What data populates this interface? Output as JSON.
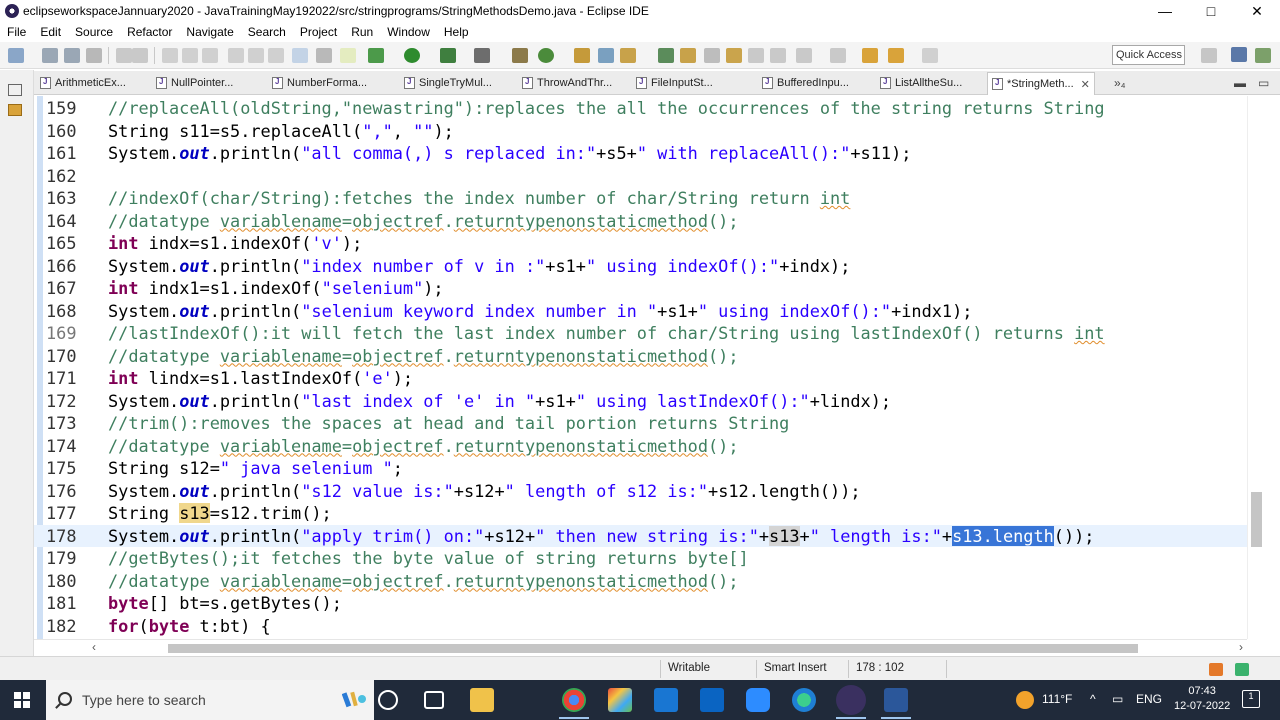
{
  "window": {
    "title": "eclipseworkspaceJannuary2020 - JavaTrainingMay192022/src/stringprograms/StringMethodsDemo.java - Eclipse IDE",
    "min": "—",
    "max": "□",
    "close": "✕"
  },
  "menu": [
    "File",
    "Edit",
    "Source",
    "Refactor",
    "Navigate",
    "Search",
    "Project",
    "Run",
    "Window",
    "Help"
  ],
  "toolbar": {
    "quick_access": "Quick Access"
  },
  "tabs": [
    {
      "label": "ArithmeticEx..."
    },
    {
      "label": "NullPointer..."
    },
    {
      "label": "NumberForma..."
    },
    {
      "label": "SingleTryMul..."
    },
    {
      "label": "ThrowAndThr..."
    },
    {
      "label": "FileInputSt..."
    },
    {
      "label": "BufferedInpu..."
    },
    {
      "label": "ListAlltheSu..."
    },
    {
      "label": "*StringMeth...",
      "active": true,
      "close": "✕"
    }
  ],
  "tab_overflow": "»₄",
  "editor": {
    "lines": [
      {
        "n": "159"
      },
      {
        "n": "160"
      },
      {
        "n": "161"
      },
      {
        "n": "162"
      },
      {
        "n": "163"
      },
      {
        "n": "164"
      },
      {
        "n": "165"
      },
      {
        "n": "166"
      },
      {
        "n": "167"
      },
      {
        "n": "168"
      },
      {
        "n": "169"
      },
      {
        "n": "170"
      },
      {
        "n": "171"
      },
      {
        "n": "172"
      },
      {
        "n": "173"
      },
      {
        "n": "174"
      },
      {
        "n": "175"
      },
      {
        "n": "176"
      },
      {
        "n": "177"
      },
      {
        "n": "178"
      },
      {
        "n": "179"
      },
      {
        "n": "180"
      },
      {
        "n": "181"
      },
      {
        "n": "182"
      }
    ],
    "code": {
      "l159a": "//replaceAll(oldString,\"newastring\"):replaces the all the occurrences of the string returns String",
      "l160a": "String s11=s5.replaceAll(",
      "l160b": "\",\"",
      "l160c": ", ",
      "l160d": "\"\"",
      "l160e": ");",
      "l161a": "System.",
      "l161b": "out",
      "l161c": ".println(",
      "l161d": "\"all comma(,) s replaced in:\"",
      "l161e": "+s5+",
      "l161f": "\" with replaceAll():\"",
      "l161g": "+s11);",
      "l163a": "//indexOf(char/String):fetches the index number of char/String return ",
      "l163b": "int",
      "l164a": "//datatype ",
      "l164b": "variablename",
      "l164c": "=",
      "l164d": "objectref",
      "l164e": ".",
      "l164f": "returntypenonstaticmethod",
      "l164g": "();",
      "l165a": "int",
      "l165b": " indx=s1.indexOf(",
      "l165c": "'v'",
      "l165d": ");",
      "l166a": "System.",
      "l166b": "out",
      "l166c": ".println(",
      "l166d": "\"index number of v in :\"",
      "l166e": "+s1+",
      "l166f": "\" using indexOf():\"",
      "l166g": "+indx);",
      "l167a": "int",
      "l167b": " indx1=s1.indexOf(",
      "l167c": "\"selenium\"",
      "l167d": ");",
      "l168a": "System.",
      "l168b": "out",
      "l168c": ".println(",
      "l168d": "\"selenium keyword index number in \"",
      "l168e": "+s1+",
      "l168f": "\" using indexOf():\"",
      "l168g": "+indx1);",
      "l169a": "//lastIndexOf():it will fetch the last index number of char/String using lastIndexOf() returns ",
      "l169b": "int",
      "l170a": "//datatype ",
      "l170b": "variablename",
      "l170c": "=",
      "l170d": "objectref",
      "l170e": ".",
      "l170f": "returntypenonstaticmethod",
      "l170g": "();",
      "l171a": "int",
      "l171b": " lindx=s1.lastIndexOf(",
      "l171c": "'e'",
      "l171d": ");",
      "l172a": "System.",
      "l172b": "out",
      "l172c": ".println(",
      "l172d": "\"last index of 'e' in \"",
      "l172e": "+s1+",
      "l172f": "\" using lastIndexOf():\"",
      "l172g": "+lindx);",
      "l173a": "//trim():removes the spaces at head and tail portion returns String",
      "l174a": "//datatype ",
      "l174b": "variablename",
      "l174c": "=",
      "l174d": "objectref",
      "l174e": ".",
      "l174f": "returntypenonstaticmethod",
      "l174g": "();",
      "l175a": "String s12=",
      "l175b": "\" java selenium \"",
      "l175c": ";",
      "l176a": "System.",
      "l176b": "out",
      "l176c": ".println(",
      "l176d": "\"s12 value is:\"",
      "l176e": "+s12+",
      "l176f": "\" length of s12 is:\"",
      "l176g": "+s12.length());",
      "l177a": "String ",
      "l177b": "s13",
      "l177c": "=s12.trim();",
      "l178a": "System.",
      "l178b": "out",
      "l178c": ".println(",
      "l178d": "\"apply trim() on:\"",
      "l178e": "+s12+",
      "l178f": "\" then new string is:\"",
      "l178g": "+",
      "l178h": "s13",
      "l178i": "+",
      "l178j": "\" length is:\"",
      "l178k": "+",
      "l178l": "s13.length",
      "l178m": "());",
      "l179a": "//getBytes();it fetches the byte value of string returns byte[]",
      "l180a": "//datatype ",
      "l180b": "variablename",
      "l180c": "=",
      "l180d": "objectref",
      "l180e": ".",
      "l180f": "returntypenonstaticmethod",
      "l180g": "();",
      "l181a": "byte",
      "l181b": "[] bt=s.getBytes();",
      "l182a": "for",
      "l182b": "(",
      "l182c": "byte",
      "l182d": " t:bt) {"
    }
  },
  "status": {
    "writable": "Writable",
    "insert": "Smart Insert",
    "position": "178 : 102"
  },
  "taskbar": {
    "search_placeholder": "Type here to search",
    "temperature": "111°F",
    "lang": "ENG",
    "time": "07:43",
    "date": "12-07-2022",
    "notif_count": "1"
  },
  "colors": {
    "keyword": "#7f0055",
    "comment": "#3f7f5f",
    "string": "#2a00ff",
    "field": "#0000c0",
    "selection": "#3875d7",
    "current_line": "#e8f2fe"
  }
}
